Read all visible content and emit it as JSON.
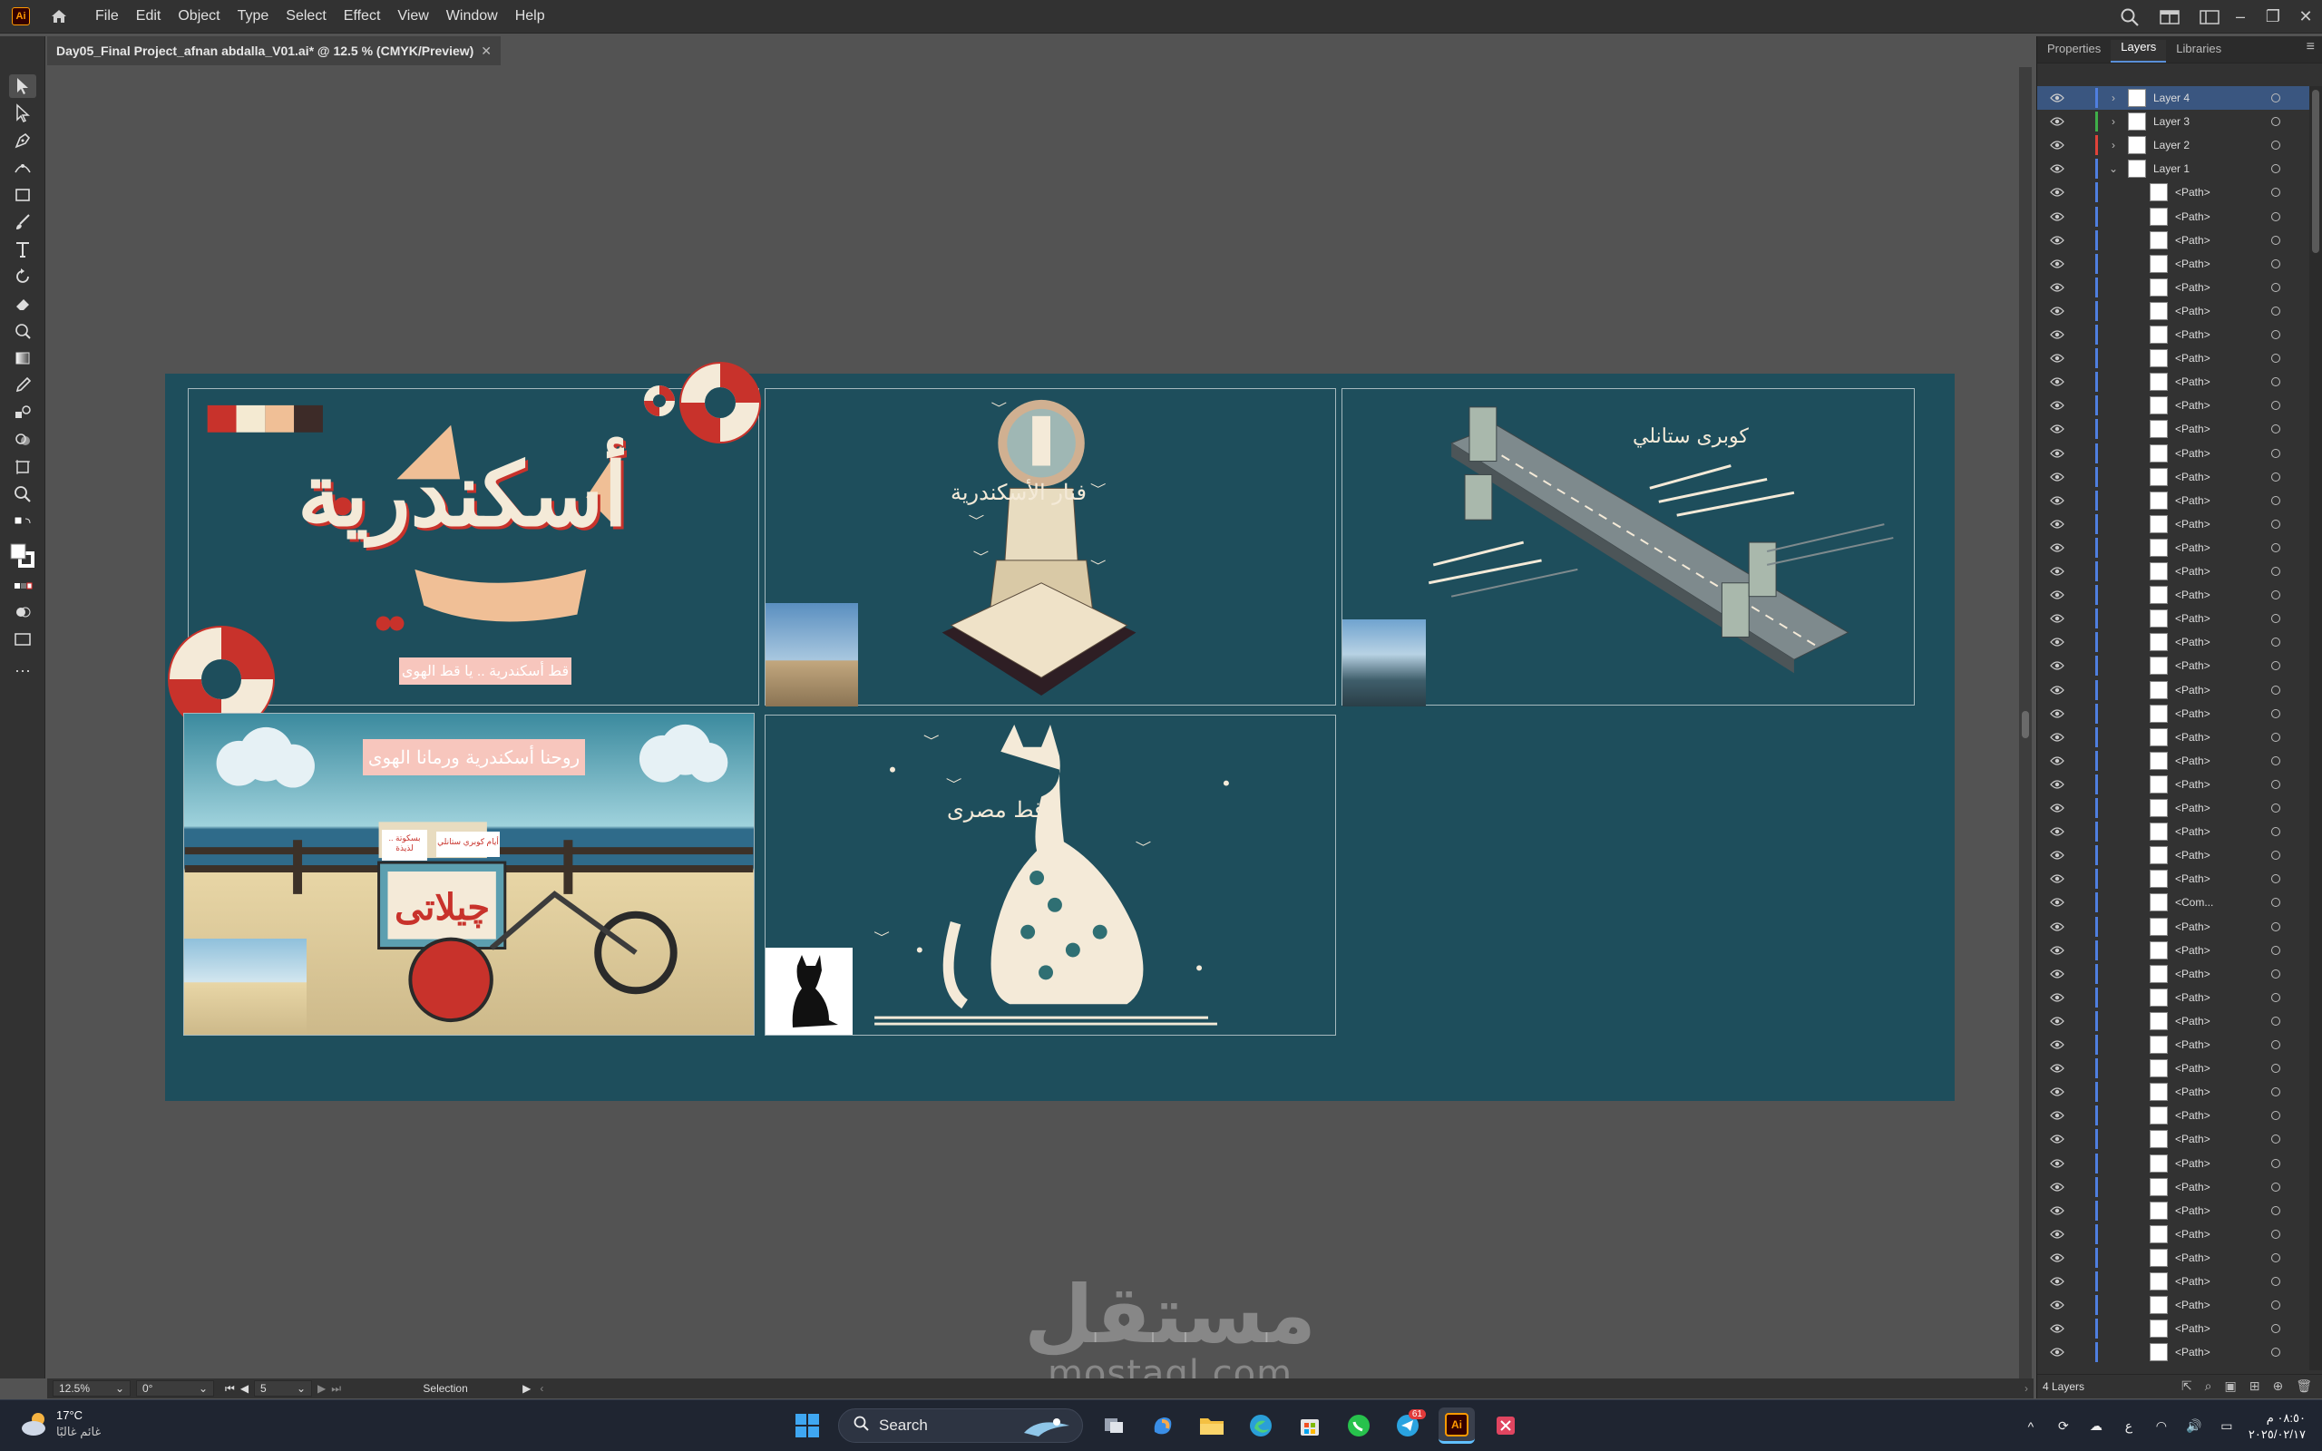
{
  "app": {
    "logo": "Ai"
  },
  "menu": [
    "File",
    "Edit",
    "Object",
    "Type",
    "Select",
    "Effect",
    "View",
    "Window",
    "Help"
  ],
  "document": {
    "tab_title": "Day05_Final Project_afnan abdalla_V01.ai* @ 12.5 % (CMYK/Preview)",
    "close": "✕"
  },
  "tools": [
    "selection-tool-icon",
    "direct-selection-tool-icon",
    "pen-tool-icon",
    "curvature-tool-icon",
    "rectangle-tool-icon",
    "paintbrush-tool-icon",
    "type-tool-icon",
    "rotate-tool-icon",
    "eraser-tool-icon",
    "warp-tool-icon",
    "gradient-tool-icon",
    "eyedropper-tool-icon",
    "blend-tool-icon",
    "shape-builder-tool-icon",
    "artboard-tool-icon",
    "zoom-tool-icon"
  ],
  "artboard": {
    "colors": {
      "bg": "#1e4e5c",
      "cream": "#f4ead8",
      "red": "#c83a2e",
      "peach": "#f0c29a"
    },
    "swatches": [
      "#c8322b",
      "#f4ead2",
      "#f0bf96",
      "#3d2b28"
    ],
    "panel1": {
      "title": "أسكندرية",
      "tag": "قط أسكندرية .. يا قط الهوى"
    },
    "panel2": {
      "title": "فنار الأسكندرية"
    },
    "panel3": {
      "title": "كوبرى ستانلي"
    },
    "panel4": {
      "title": "روحنا أسكندرية ورمانا الهوى",
      "cart_sign": "چيلاتى",
      "sign_left": "بسكوتة .. لذيذة",
      "sign_right": "أيام كوبري ستانلي"
    },
    "panel5": {
      "title": "قط مصرى"
    }
  },
  "status": {
    "zoom": "12.5%",
    "angle": "0°",
    "artboard_num": "5",
    "tool": "Selection"
  },
  "panel": {
    "tabs": [
      "Properties",
      "Layers",
      "Libraries"
    ],
    "active_tab": "Layers",
    "layers": [
      {
        "name": "Layer 4",
        "color": "#4f7fe0",
        "expand": "›",
        "selected": true
      },
      {
        "name": "Layer 3",
        "color": "#3fae49",
        "expand": "›",
        "selected": false
      },
      {
        "name": "Layer 2",
        "color": "#e0433a",
        "expand": "›",
        "selected": false
      },
      {
        "name": "Layer 1",
        "color": "#4f7fe0",
        "expand": "⌄",
        "selected": false
      }
    ],
    "sublayers": [
      "<Path>",
      "<Path>",
      "<Path>",
      "<Path>",
      "<Path>",
      "<Path>",
      "<Path>",
      "<Path>",
      "<Path>",
      "<Path>",
      "<Path>",
      "<Path>",
      "<Path>",
      "<Path>",
      "<Path>",
      "<Path>",
      "<Path>",
      "<Path>",
      "<Path>",
      "<Path>",
      "<Path>",
      "<Path>",
      "<Path>",
      "<Path>",
      "<Path>",
      "<Path>",
      "<Path>",
      "<Path>",
      "<Path>",
      "<Path>",
      "<Com...",
      "<Path>",
      "<Path>",
      "<Path>",
      "<Path>",
      "<Path>",
      "<Path>",
      "<Path>",
      "<Path>",
      "<Path>",
      "<Path>",
      "<Path>",
      "<Path>",
      "<Path>",
      "<Path>",
      "<Path>",
      "<Path>",
      "<Path>",
      "<Path>",
      "<Path>"
    ],
    "footer": "4 Layers"
  },
  "taskbar": {
    "weather_temp": "17°C",
    "weather_desc": "غائم غالبًا",
    "search": "Search",
    "telegram_badge": "61",
    "time": "٠٨:٥٠ م",
    "date": "٢٠٢٥/٠٢/١٧",
    "lang": "ع"
  },
  "watermark": {
    "line1": "مستقل",
    "line2": "mostaql.com"
  }
}
